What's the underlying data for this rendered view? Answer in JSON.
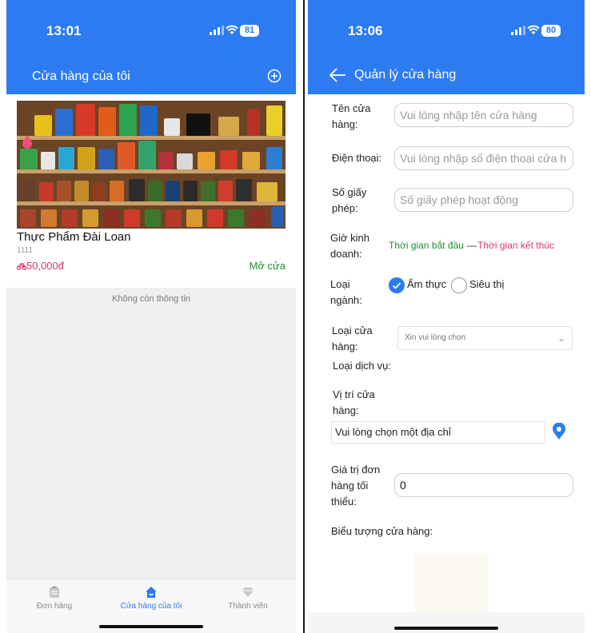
{
  "screen1": {
    "status": {
      "time": "13:01",
      "battery": "81"
    },
    "title": "Cửa hàng của tôi",
    "store": {
      "name": "Thực Phẩm Đài Loan",
      "id": "1111",
      "price": "50,000đ",
      "status": "Mở cửa"
    },
    "no_more": "Không còn thông tin",
    "tabs": [
      {
        "label": "Đơn hàng",
        "icon": "clipboard-icon"
      },
      {
        "label": "Cửa hàng của tôi",
        "icon": "home-icon"
      },
      {
        "label": "Thành viên",
        "icon": "diamond-icon"
      }
    ]
  },
  "screen2": {
    "status": {
      "time": "13:06",
      "battery": "80"
    },
    "title": "Quản lý cửa hàng",
    "form": {
      "store_name": {
        "label_l1": "Tên cửa",
        "label_l2": "hàng:",
        "placeholder": "Vui lòng nhập tên cửa hàng"
      },
      "phone": {
        "label": "Điện thoại:",
        "placeholder": "Vui lòng nhập số điện thoại cửa h"
      },
      "license": {
        "label_l1": "Số giấy",
        "label_l2": "phép:",
        "placeholder": "Số giấy phép hoạt động"
      },
      "hours": {
        "label_l1": "Giờ kinh",
        "label_l2": "doanh:",
        "start": "Thời gian bắt đầu",
        "dash": "—",
        "end": "Thời gian kết thúc"
      },
      "industry": {
        "label_l1": "Loại",
        "label_l2": "ngành:",
        "option1": "Ẩm thực",
        "option2": "Siêu thị",
        "selected": "Ẩm thực"
      },
      "store_type": {
        "label_l1": "Loại cửa",
        "label_l2": "hàng:",
        "placeholder": "Xin vui lòng chọn"
      },
      "service_type": {
        "label": "Loại dịch vụ:"
      },
      "location": {
        "label_l1": "Vị trí cửa",
        "label_l2": "hàng:",
        "placeholder": "Vui lòng chọn một địa chỉ"
      },
      "min_order": {
        "label_l1": "Giá trị đơn",
        "label_l2": "hàng tối",
        "label_l3": "thiểu:",
        "value": "0"
      },
      "store_icon": {
        "label": "Biểu tượng cửa hàng:"
      }
    }
  },
  "colors": {
    "primary": "#2d7bf1",
    "green": "#1f8f2e",
    "pink": "#e0336a"
  }
}
